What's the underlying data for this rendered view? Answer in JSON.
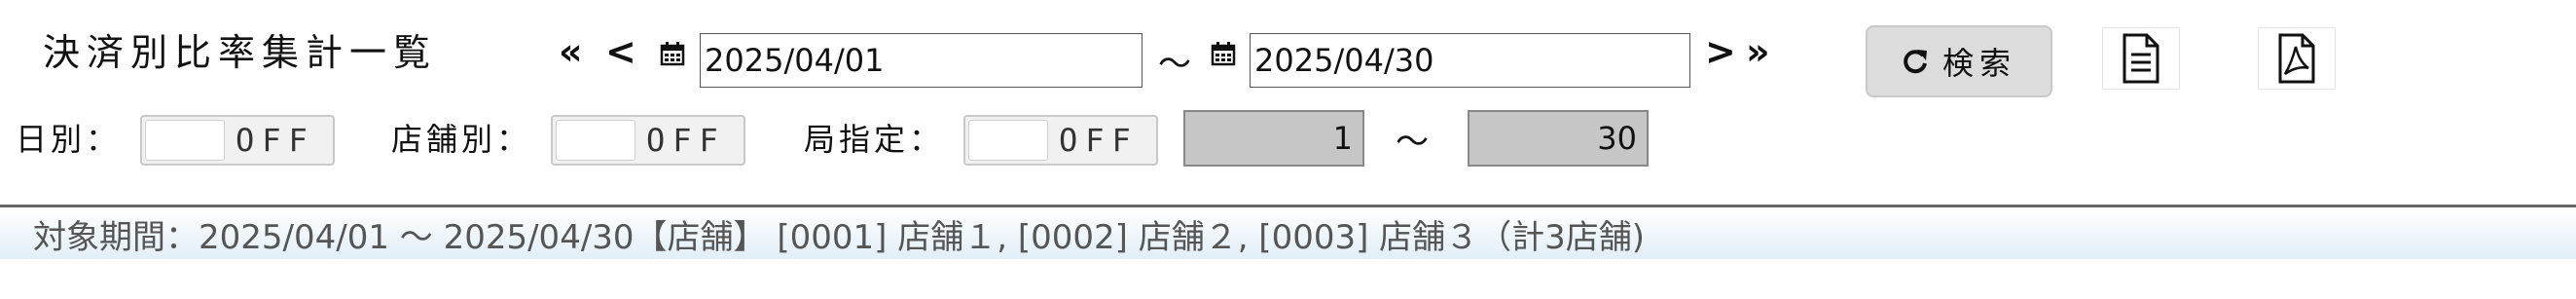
{
  "header": {
    "title": "決済別比率集計一覧",
    "nav_first": "«",
    "nav_prev": "<",
    "nav_next": ">",
    "nav_last": "»",
    "date_from": "2025/04/01",
    "date_to": "2025/04/30",
    "range_sep": "～",
    "search_label": "検索",
    "icons": {
      "calendar": "calendar-icon",
      "refresh": "refresh-icon",
      "document": "document-icon",
      "pdf": "pdf-icon"
    }
  },
  "filters": {
    "daily_label": "日別：",
    "daily_state": "OFF",
    "store_label": "店舗別：",
    "store_state": "OFF",
    "station_label": "局指定：",
    "station_state": "OFF",
    "station_from": "1",
    "station_sep": "～",
    "station_to": "30"
  },
  "period": {
    "text": "対象期間：2025/04/01 ～ 2025/04/30【店舗】 [0001] 店舗１, [0002] 店舗２, [0003] 店舗３（計3店舗)"
  },
  "colors": {
    "search_bg": "#dcdcdc",
    "readonly_input_bg": "#c6c6c6",
    "period_bar_gradient_end": "#e1eef8"
  }
}
